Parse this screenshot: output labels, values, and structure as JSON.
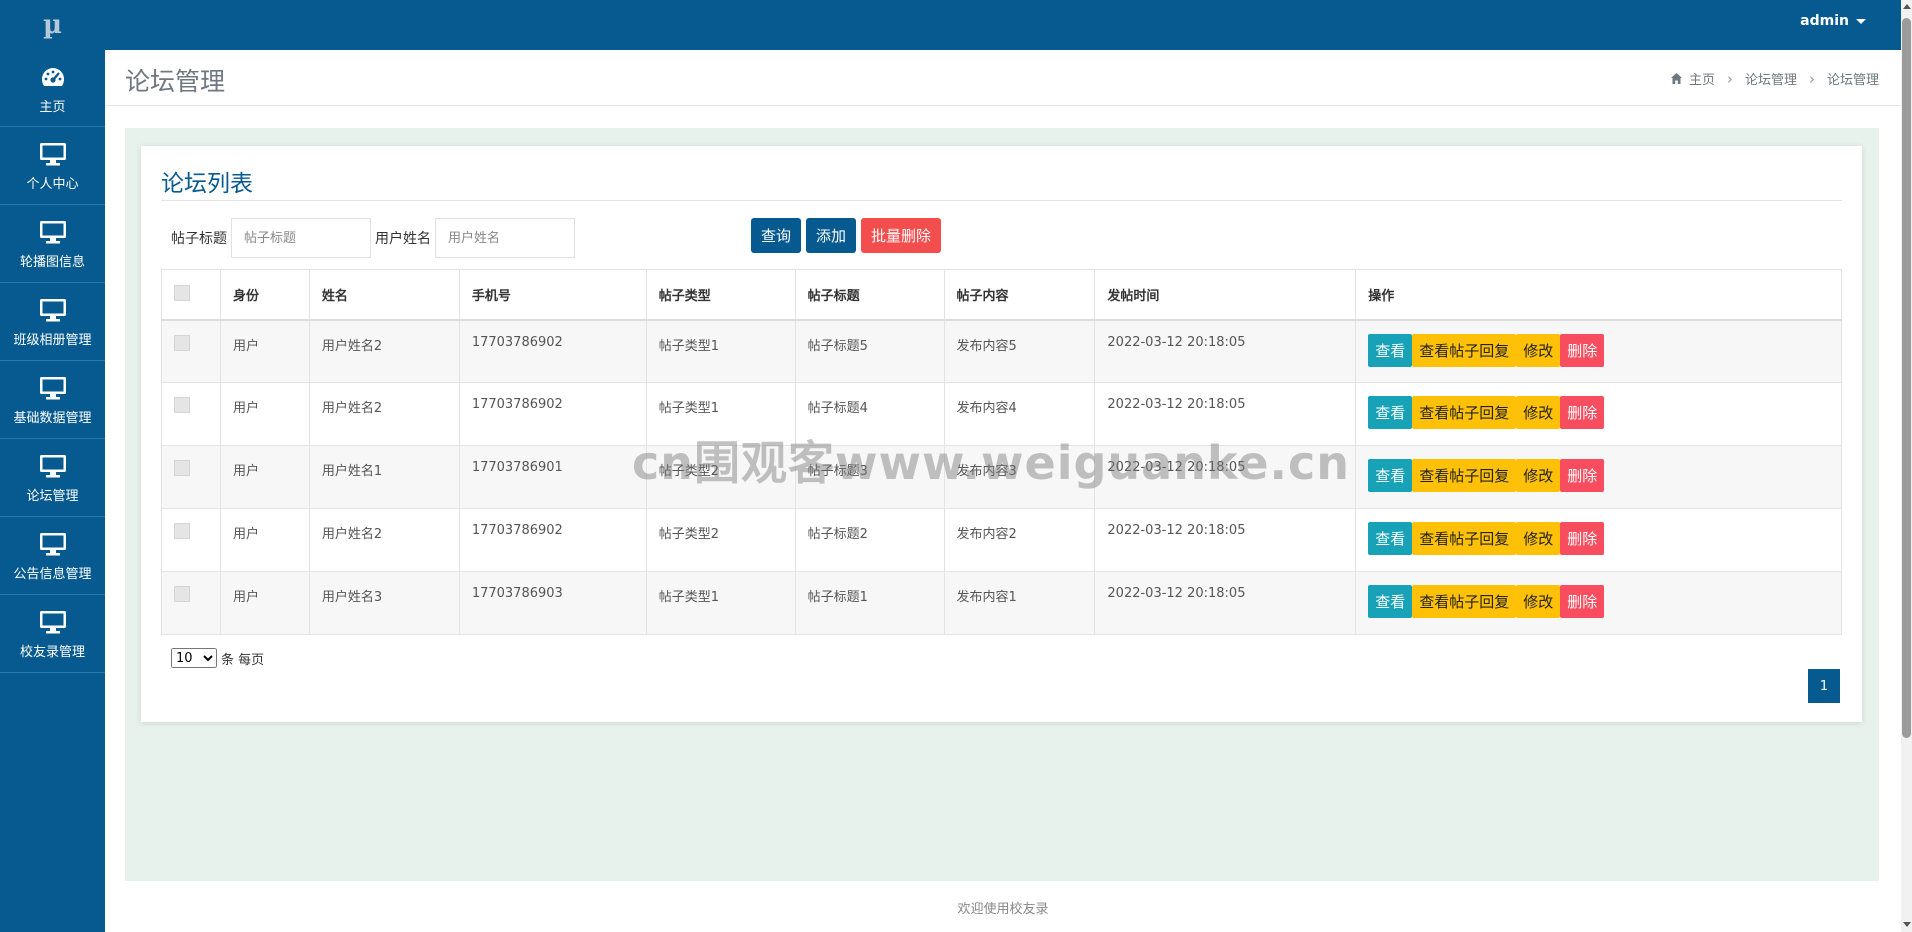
{
  "brand": {
    "logo": "µ"
  },
  "topbar": {
    "user": "admin"
  },
  "sidebar": {
    "items": [
      {
        "label": "主页",
        "icon": "dashboard-icon"
      },
      {
        "label": "个人中心",
        "icon": "monitor-icon"
      },
      {
        "label": "轮播图信息",
        "icon": "monitor-icon"
      },
      {
        "label": "班级相册管理",
        "icon": "monitor-icon"
      },
      {
        "label": "基础数据管理",
        "icon": "monitor-icon"
      },
      {
        "label": "论坛管理",
        "icon": "monitor-icon"
      },
      {
        "label": "公告信息管理",
        "icon": "monitor-icon"
      },
      {
        "label": "校友录管理",
        "icon": "monitor-icon"
      }
    ]
  },
  "header": {
    "title": "论坛管理",
    "breadcrumb": [
      "主页",
      "论坛管理",
      "论坛管理"
    ]
  },
  "card": {
    "title": "论坛列表",
    "search": {
      "title_label": "帖子标题",
      "title_placeholder": "帖子标题",
      "name_label": "用户姓名",
      "name_placeholder": "用户姓名"
    },
    "buttons": {
      "query": "查询",
      "add": "添加",
      "batch_delete": "批量删除"
    }
  },
  "table": {
    "columns": [
      "身份",
      "姓名",
      "手机号",
      "帖子类型",
      "帖子标题",
      "帖子内容",
      "发帖时间",
      "操作"
    ],
    "rows": [
      [
        "用户",
        "用户姓名2",
        "17703786902",
        "帖子类型1",
        "帖子标题5",
        "发布内容5",
        "2022-03-12 20:18:05"
      ],
      [
        "用户",
        "用户姓名2",
        "17703786902",
        "帖子类型1",
        "帖子标题4",
        "发布内容4",
        "2022-03-12 20:18:05"
      ],
      [
        "用户",
        "用户姓名1",
        "17703786901",
        "帖子类型2",
        "帖子标题3",
        "发布内容3",
        "2022-03-12 20:18:05"
      ],
      [
        "用户",
        "用户姓名2",
        "17703786902",
        "帖子类型2",
        "帖子标题2",
        "发布内容2",
        "2022-03-12 20:18:05"
      ],
      [
        "用户",
        "用户姓名3",
        "17703786903",
        "帖子类型1",
        "帖子标题1",
        "发布内容1",
        "2022-03-12 20:18:05"
      ]
    ],
    "row_actions": {
      "view": "查看",
      "reply": "查看帖子回复",
      "edit": "修改",
      "delete": "删除"
    }
  },
  "pager": {
    "size": "10",
    "size_suffix": "条 每页",
    "page": "1"
  },
  "watermark": "cn围观客www.weiguanke.cn",
  "footer": "欢迎使用校友录",
  "colors": {
    "primary": "#075a8f",
    "danger": "#f34d4d",
    "info": "#17a2b8",
    "warning": "#ffc107",
    "content_bg": "#e8f2ec"
  }
}
